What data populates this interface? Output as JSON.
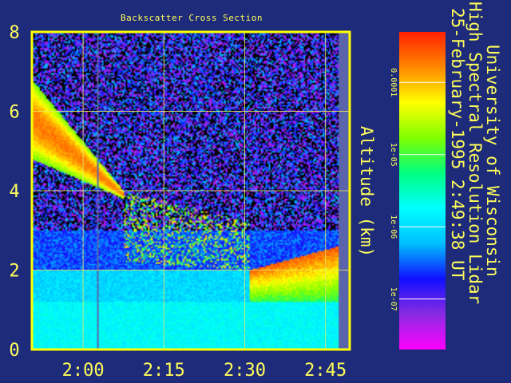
{
  "chart_data": {
    "type": "heatmap",
    "title": "Backscatter Cross Section",
    "ylabel": "Altitude (km)",
    "xlabel": "",
    "x_tick_labels": [
      "2:00",
      "2:15",
      "2:30",
      "2:45"
    ],
    "x_tick_values_min": [
      0,
      15,
      30,
      45
    ],
    "x_range_min": [
      -9.5,
      49.5
    ],
    "y_tick_labels": [
      "0",
      "2",
      "4",
      "6",
      "8"
    ],
    "y_tick_values": [
      0,
      2,
      4,
      6,
      8
    ],
    "ylim": [
      0,
      8
    ],
    "grid": true,
    "colorbar": {
      "scale": "log",
      "tick_labels": [
        "0.0001",
        "1e-05",
        "1e-06",
        "1e-07"
      ],
      "tick_values": [
        0.0001,
        1e-05,
        1e-06,
        1e-07
      ],
      "range": [
        2e-08,
        0.0005
      ],
      "colors": [
        "#ff00ff",
        "#8a2be2",
        "#1010ff",
        "#00bfff",
        "#00ffff",
        "#00ff80",
        "#80ff00",
        "#ffff00",
        "#ff8800",
        "#ff2000"
      ]
    },
    "features": [
      {
        "name": "sloping cloud layer",
        "x_start": -9.5,
        "x_end": 7.5,
        "top_km": [
          6.8,
          4.0
        ],
        "bottom_km": [
          4.8,
          3.8
        ]
      },
      {
        "name": "cloud fragments",
        "x_start": 7.5,
        "x_end": 31.0,
        "top_km": [
          4.0,
          3.2
        ],
        "bottom_km": [
          2.2,
          2.0
        ]
      },
      {
        "name": "low cloud / boundary layer",
        "x_start": 31.0,
        "x_end": 47.5,
        "top_km": [
          2.0,
          2.6
        ],
        "bottom_km": [
          1.2,
          1.2
        ]
      },
      {
        "name": "missing data gap",
        "x_start": 2.5,
        "x_end": 3.0
      },
      {
        "name": "missing data gap",
        "x_start": 47.5,
        "x_end": 49.5
      }
    ]
  },
  "header": {
    "line1": "University of Wisconsin",
    "line2": "High Spectral Resolution Lidar",
    "line3": "25-February-1995   2:49:38 UT"
  },
  "colors": {
    "background": "#1e2a7a",
    "axis": "#ffff00",
    "grid": "#e8e860",
    "text": "#ffff5a"
  }
}
